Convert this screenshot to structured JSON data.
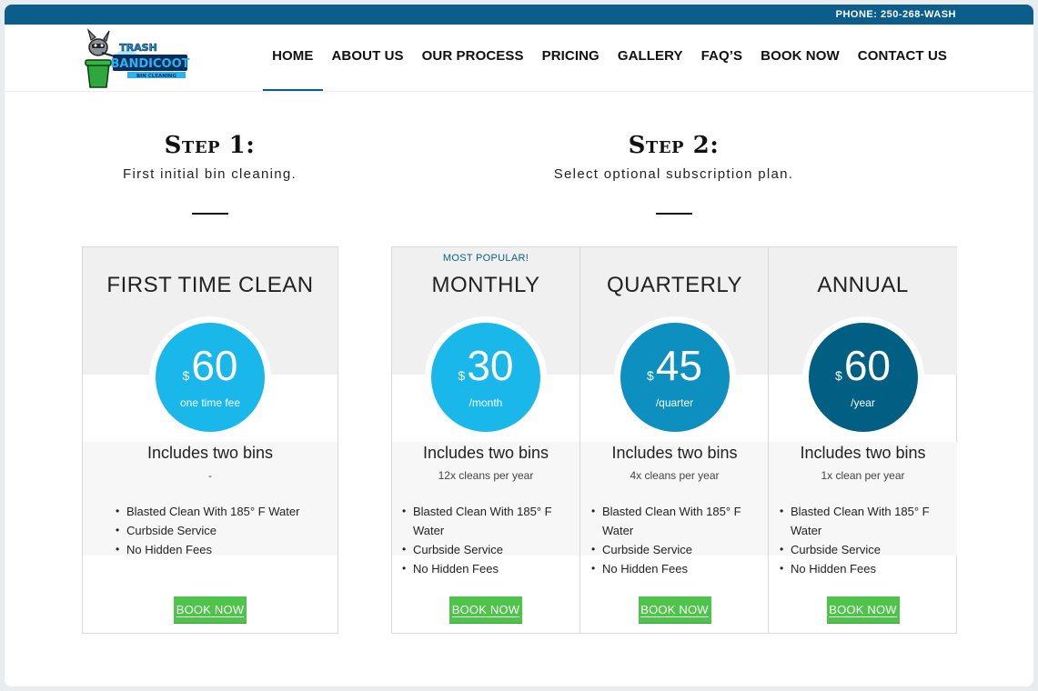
{
  "topbar": {
    "phone": "PHONE: 250-268-WASH"
  },
  "logo": {
    "line1": "TRASH",
    "line2": "BANDICOOT",
    "line3": "BIN CLEANING"
  },
  "nav": {
    "items": [
      "HOME",
      "ABOUT US",
      "OUR PROCESS",
      "PRICING",
      "GALLERY",
      "FAQ’S",
      "BOOK NOW",
      "CONTACT US"
    ],
    "active": "HOME"
  },
  "steps": [
    {
      "title": "Step 1:",
      "subtitle": "First initial bin cleaning."
    },
    {
      "title": "Step 2:",
      "subtitle": "Select optional subscription plan."
    }
  ],
  "colors": {
    "brand": "#0b5e8c",
    "button": "#4ec54a",
    "circle_first": "#1ab7ea",
    "circle_monthly": "#1ab7ea",
    "circle_quarterly": "#0d8fbf",
    "circle_annual": "#005f83"
  },
  "plans": [
    {
      "badge": "",
      "name": "FIRST TIME CLEAN",
      "currency": "$",
      "price": "60",
      "period": "one time fee",
      "includes": "Includes two bins",
      "cleans": "-",
      "features": [
        "Blasted Clean With 185° F Water",
        "Curbside Service",
        "No Hidden Fees"
      ],
      "button": "BOOK NOW"
    },
    {
      "badge": "MOST POPULAR!",
      "name": "MONTHLY",
      "currency": "$",
      "price": "30",
      "period": "/month",
      "includes": "Includes two bins",
      "cleans": "12x cleans per year",
      "features": [
        "Blasted Clean With 185° F Water",
        "Curbside Service",
        "No Hidden Fees"
      ],
      "button": "BOOK NOW"
    },
    {
      "badge": "",
      "name": "QUARTERLY",
      "currency": "$",
      "price": "45",
      "period": "/quarter",
      "includes": "Includes two bins",
      "cleans": "4x cleans per year",
      "features": [
        "Blasted Clean With 185° F Water",
        "Curbside Service",
        "No Hidden Fees"
      ],
      "button": "BOOK NOW"
    },
    {
      "badge": "",
      "name": "ANNUAL",
      "currency": "$",
      "price": "60",
      "period": "/year",
      "includes": "Includes two bins",
      "cleans": "1x clean per year",
      "features": [
        "Blasted Clean With 185° F Water",
        "Curbside Service",
        "No Hidden Fees"
      ],
      "button": "BOOK NOW"
    }
  ]
}
